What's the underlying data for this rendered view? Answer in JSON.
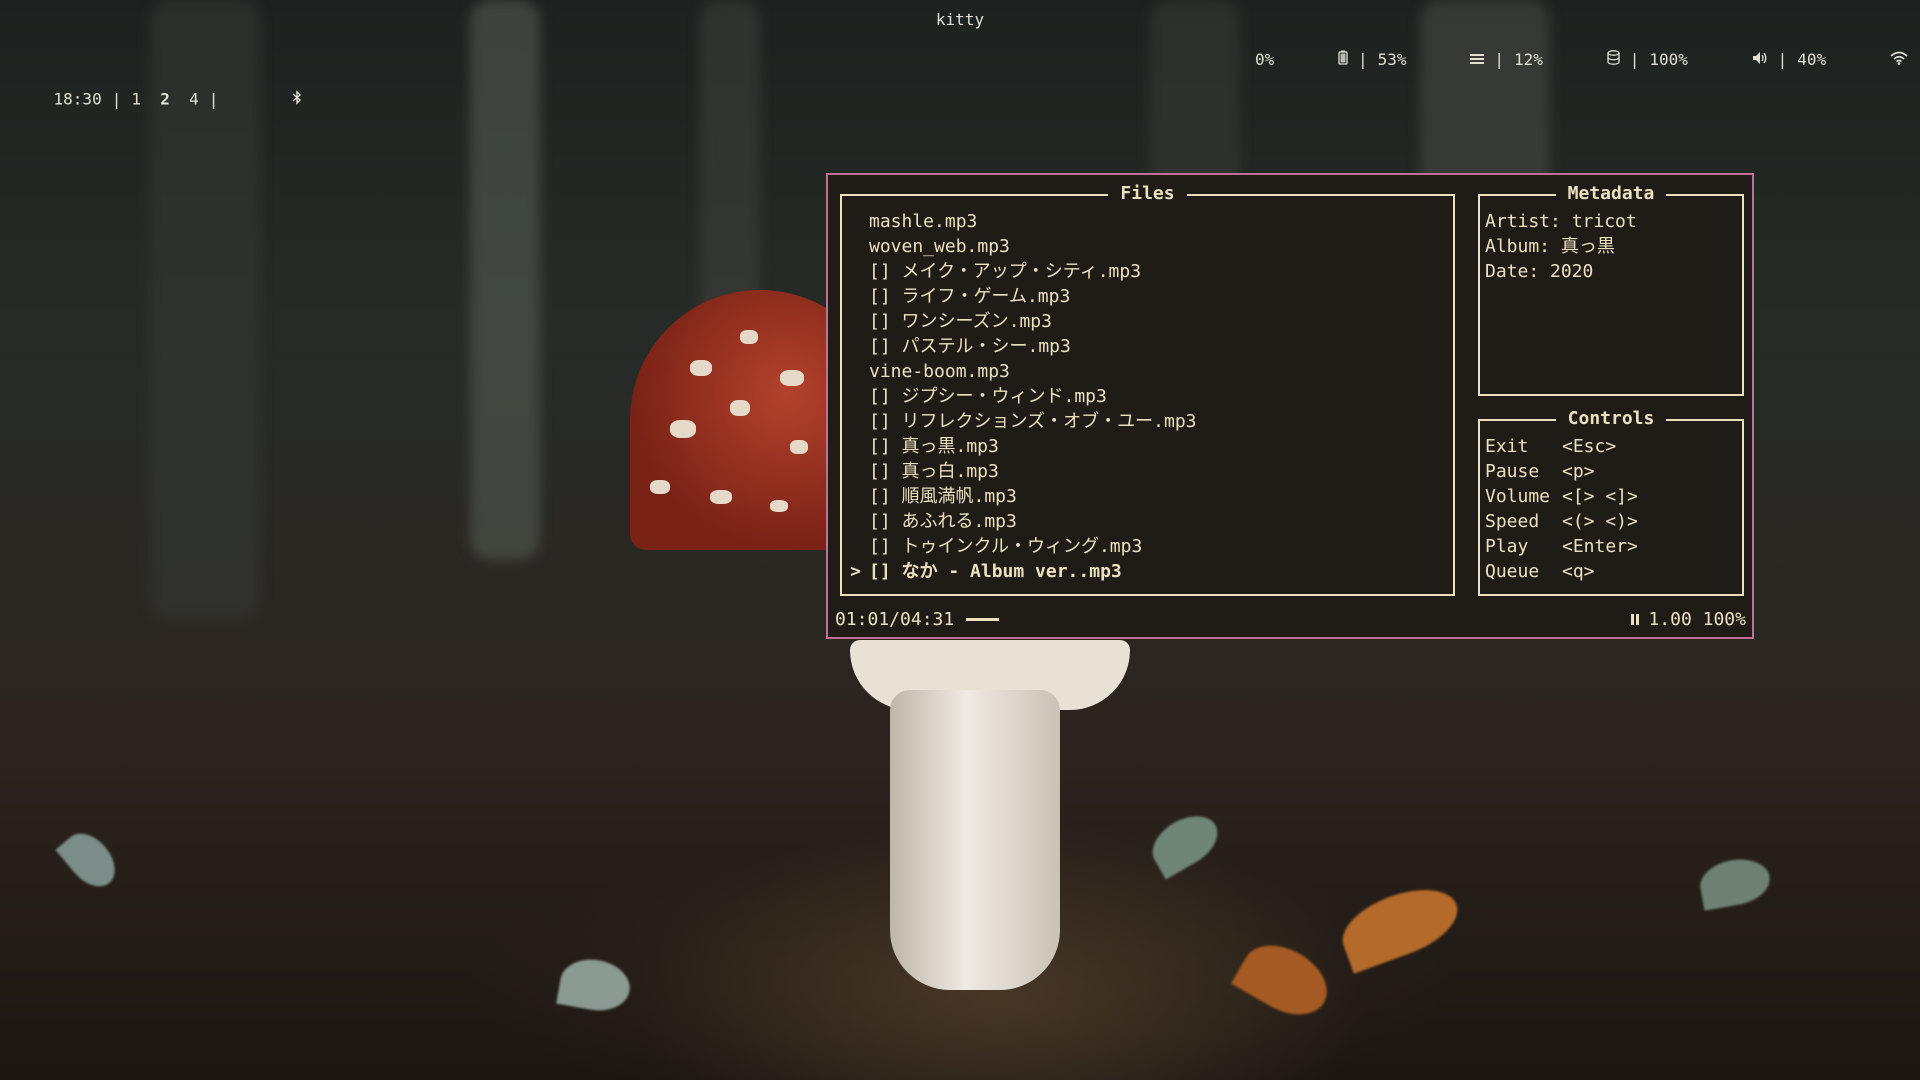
{
  "statusbar": {
    "time": "18:30",
    "workspaces": [
      {
        "label": "1",
        "active": false
      },
      {
        "label": "2",
        "active": true
      },
      {
        "label": "4",
        "active": false
      }
    ],
    "window_title": "kitty",
    "indicators": [
      {
        "value": "0%",
        "icon": "battery-icon"
      },
      {
        "value": "53%",
        "icon": "cpu-icon"
      },
      {
        "value": "12%",
        "icon": "disk-icon"
      },
      {
        "value": "100%",
        "icon": "volume-icon"
      },
      {
        "value": "40%",
        "icon": "wifi-icon"
      }
    ]
  },
  "player": {
    "files_title": "Files",
    "files": [
      {
        "name": "mashle.mp3",
        "selected": false
      },
      {
        "name": "woven_web.mp3",
        "selected": false
      },
      {
        "name": "[] メイク・アップ・シティ.mp3",
        "selected": false
      },
      {
        "name": "[] ライフ・ゲーム.mp3",
        "selected": false
      },
      {
        "name": "[] ワンシーズン.mp3",
        "selected": false
      },
      {
        "name": "[] パステル・シー.mp3",
        "selected": false
      },
      {
        "name": "vine-boom.mp3",
        "selected": false
      },
      {
        "name": "[] ジプシー・ウィンド.mp3",
        "selected": false
      },
      {
        "name": "[] リフレクションズ・オブ・ユー.mp3",
        "selected": false
      },
      {
        "name": "[] 真っ黒.mp3",
        "selected": false
      },
      {
        "name": "[] 真っ白.mp3",
        "selected": false
      },
      {
        "name": "[] 順風満帆.mp3",
        "selected": false
      },
      {
        "name": "[] あふれる.mp3",
        "selected": false
      },
      {
        "name": "[] トゥインクル・ウィング.mp3",
        "selected": false
      },
      {
        "name": "[] なか - Album ver..mp3",
        "selected": true
      }
    ],
    "cursor_symbol": ">",
    "metadata_title": "Metadata",
    "metadata": {
      "artist": "Artist: tricot",
      "album": "Album: 真っ黒",
      "date": "Date: 2020"
    },
    "controls_title": "Controls",
    "controls": [
      {
        "action": "Exit",
        "key": "<Esc>"
      },
      {
        "action": "Pause",
        "key": "<p>"
      },
      {
        "action": "Volume",
        "key": "<[> <]>"
      },
      {
        "action": "Speed",
        "key": "<(> <)>"
      },
      {
        "action": "Play",
        "key": "<Enter>"
      },
      {
        "action": "Queue",
        "key": "<q>"
      }
    ],
    "status": {
      "time": "01:01/04:31",
      "progress": 0.225,
      "state_icon": "pause-icon",
      "speed_volume": "1.00 100%"
    }
  },
  "colors": {
    "accent_border": "#c06f95",
    "text": "#ece1bf",
    "terminal_bg": "#1f1c18"
  }
}
